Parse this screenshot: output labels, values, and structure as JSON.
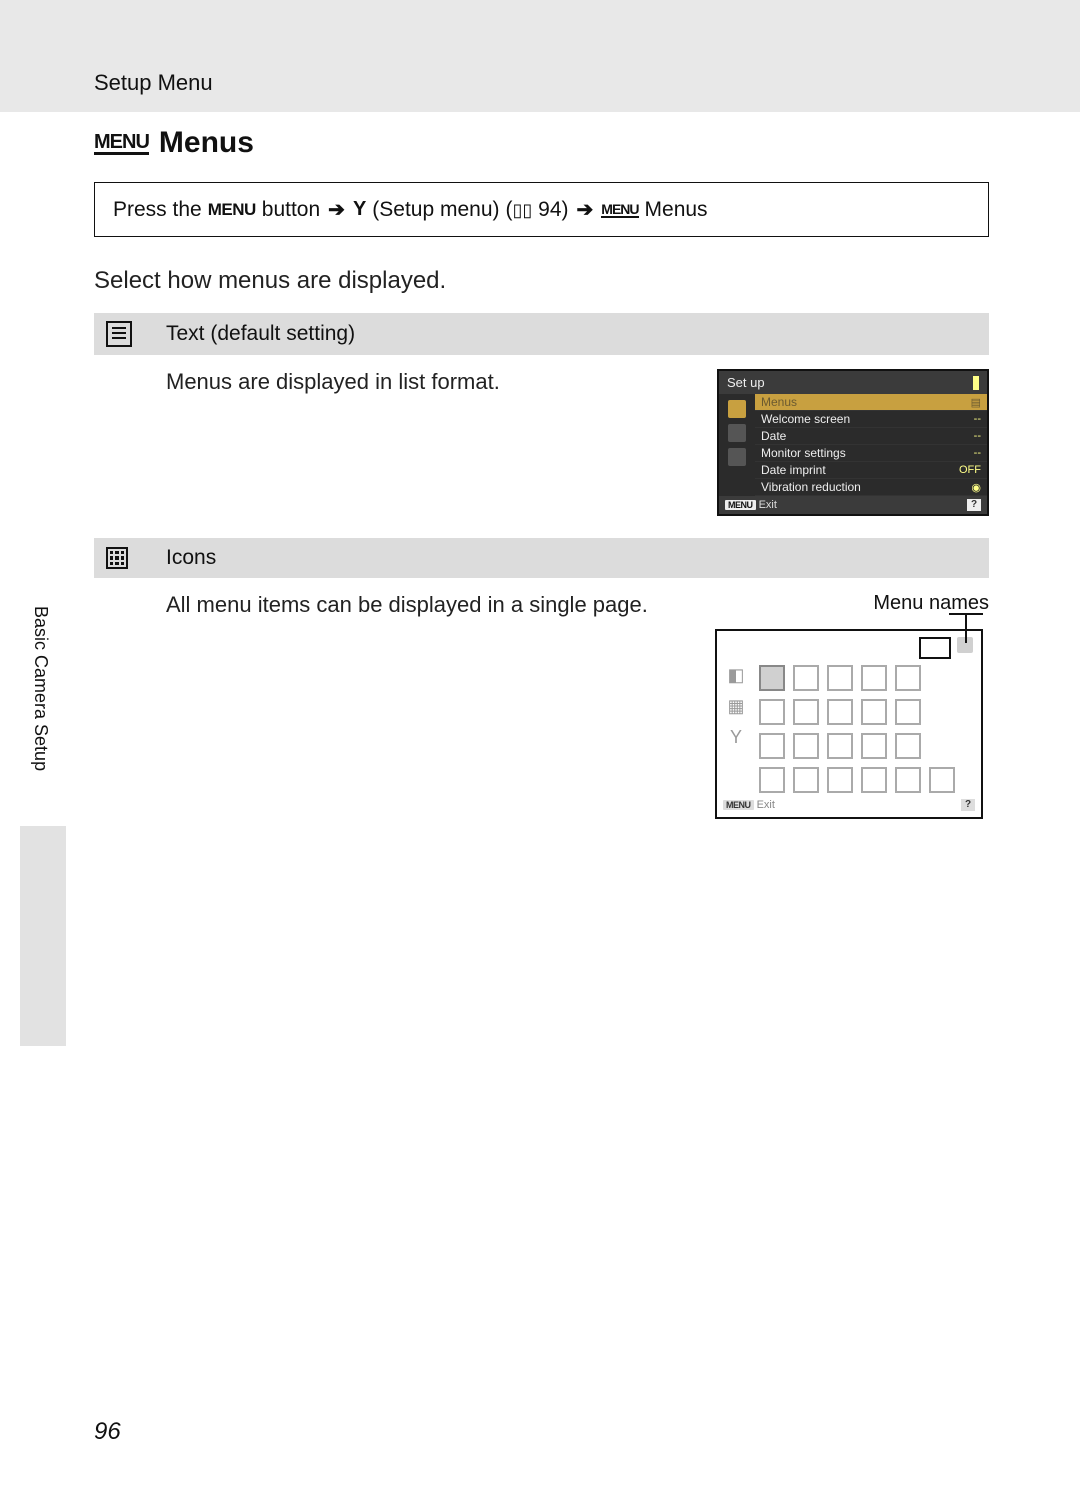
{
  "header": {
    "section": "Setup Menu"
  },
  "title": "Menus",
  "nav_path": {
    "prefix": "Press the",
    "menu_label": "MENU",
    "mid": "button",
    "step2_label": "(Setup menu)",
    "ref_page": "94",
    "step3_label": "Menus"
  },
  "intro": "Select how menus are displayed.",
  "options": [
    {
      "label": "Text (default setting)",
      "desc": "Menus are displayed in list format."
    },
    {
      "label": "Icons",
      "desc": "All menu items can be displayed in a single page."
    }
  ],
  "lcd_text": {
    "header": "Set up",
    "rows": [
      {
        "label": "Menus",
        "val": "▤"
      },
      {
        "label": "Welcome screen",
        "val": "--"
      },
      {
        "label": "Date",
        "val": "--"
      },
      {
        "label": "Monitor settings",
        "val": "--"
      },
      {
        "label": "Date imprint",
        "val": "OFF"
      },
      {
        "label": "Vibration reduction",
        "val": "◉"
      }
    ],
    "footer_exit": "Exit",
    "footer_menu": "MENU"
  },
  "lcd_icons": {
    "callout": "Menu names",
    "footer_exit": "Exit",
    "footer_menu": "MENU"
  },
  "side_tab": "Basic Camera Setup",
  "page_number": "96"
}
